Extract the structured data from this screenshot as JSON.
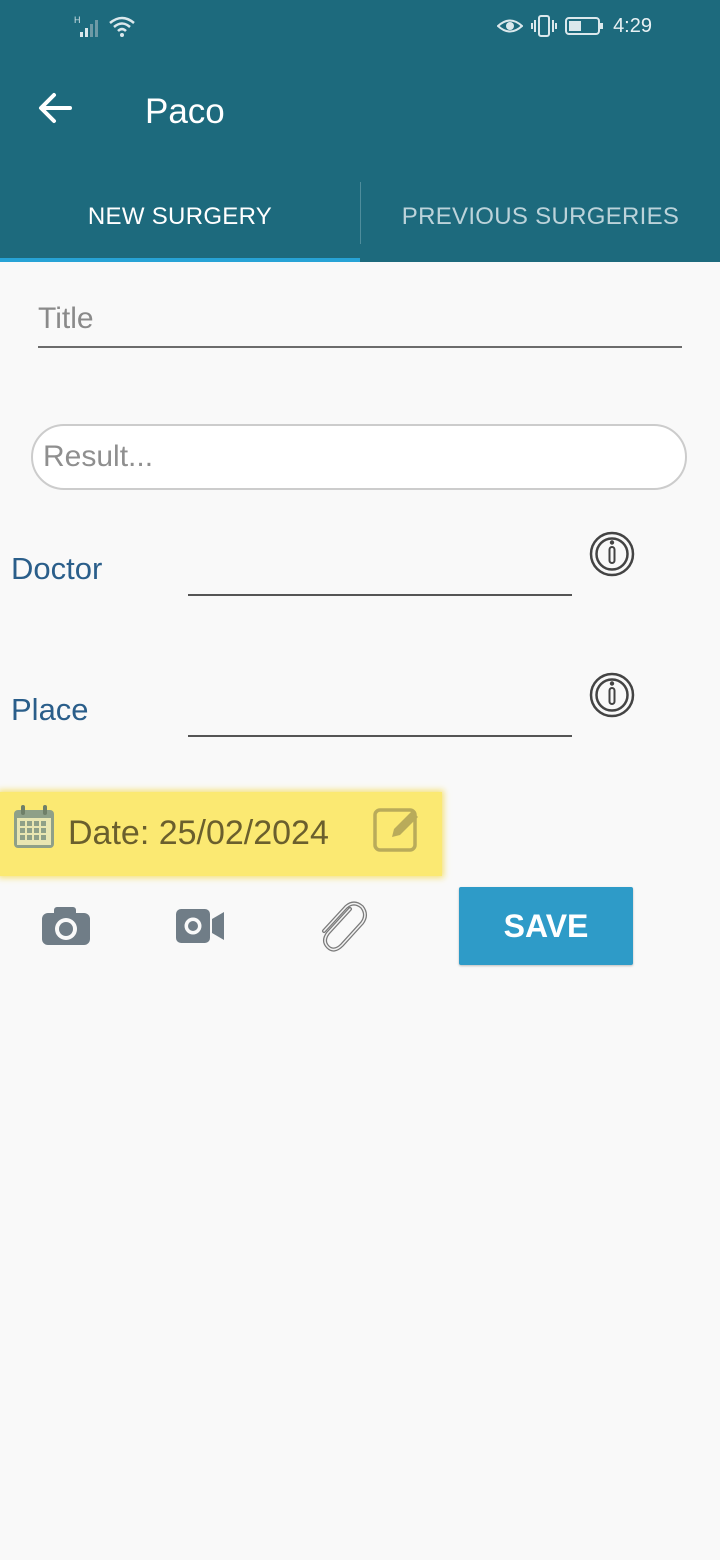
{
  "status_bar": {
    "network_type": "H",
    "time": "4:29",
    "icons": [
      "signal-icon",
      "wifi-icon",
      "eye-icon",
      "vibrate-icon",
      "battery-icon"
    ]
  },
  "app_bar": {
    "title": "Paco",
    "back_icon": "arrow-left-icon"
  },
  "tabs": [
    {
      "label": "NEW SURGERY",
      "active": true
    },
    {
      "label": "PREVIOUS SURGERIES",
      "active": false
    }
  ],
  "form": {
    "title_placeholder": "Title",
    "title_value": "",
    "result_placeholder": "Result...",
    "result_value": "",
    "doctor_label": "Doctor",
    "doctor_value": "",
    "place_label": "Place",
    "place_value": "",
    "date_text": "Date: 25/02/2024",
    "save_label": "SAVE"
  },
  "colors": {
    "primary": "#1d6a7d",
    "tab_indicator": "#27a3d6",
    "label": "#2a5e8a",
    "date_highlight": "#fbe972",
    "save_button": "#2e9bc8"
  }
}
